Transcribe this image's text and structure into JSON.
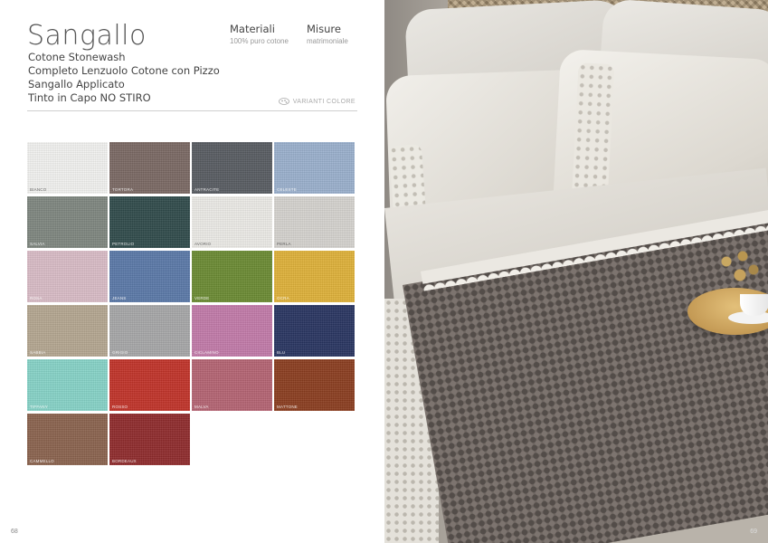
{
  "product": {
    "title": "Sangallo",
    "lines": [
      "Cotone Stonewash",
      "Completo Lenzuolo Cotone con Pizzo",
      "Sangallo Applicato",
      "Tinto in Capo NO STIRO"
    ]
  },
  "specs": {
    "materiali": {
      "label": "Materiali",
      "value": "100% puro cotone"
    },
    "misure": {
      "label": "Misure",
      "value": "matrimoniale"
    }
  },
  "varianti_label": "VARIANTI COLORE",
  "swatches": [
    {
      "name": "BIANCO",
      "color": "#f2f2f0",
      "light": true
    },
    {
      "name": "TORTORA",
      "color": "#7a6863",
      "light": false
    },
    {
      "name": "ANTRACITE",
      "color": "#575b61",
      "light": false
    },
    {
      "name": "CELESTE",
      "color": "#9ab0cd",
      "light": false
    },
    {
      "name": "SALVIA",
      "color": "#7e867f",
      "light": false
    },
    {
      "name": "PETROLIO",
      "color": "#2f4a4a",
      "light": false
    },
    {
      "name": "AVORIO",
      "color": "#ecebe7",
      "light": true
    },
    {
      "name": "PERLA",
      "color": "#d5d3cf",
      "light": true
    },
    {
      "name": "ROSA",
      "color": "#d9bcc6",
      "light": false
    },
    {
      "name": "JEANS",
      "color": "#5a78a8",
      "light": false
    },
    {
      "name": "VERDE",
      "color": "#6a8a32",
      "light": false
    },
    {
      "name": "OCRA",
      "color": "#dfb138",
      "light": false
    },
    {
      "name": "SABBIA",
      "color": "#b4a690",
      "light": false
    },
    {
      "name": "GRIGIO",
      "color": "#a6a7a8",
      "light": false
    },
    {
      "name": "CICLAMINO",
      "color": "#c27aa9",
      "light": false
    },
    {
      "name": "BLU",
      "color": "#283460",
      "light": false
    },
    {
      "name": "TIFFANY",
      "color": "#86d3c7",
      "light": false
    },
    {
      "name": "ROSSO",
      "color": "#c13228",
      "light": false
    },
    {
      "name": "MALVA",
      "color": "#b46372",
      "light": false
    },
    {
      "name": "MATTONE",
      "color": "#8a3c1e",
      "light": false
    },
    {
      "name": "CAMMELLO",
      "color": "#8a624d",
      "light": false
    },
    {
      "name": "BORDEAUX",
      "color": "#8f2a2b",
      "light": false
    }
  ],
  "page_numbers": {
    "left": "68",
    "right": "69"
  }
}
